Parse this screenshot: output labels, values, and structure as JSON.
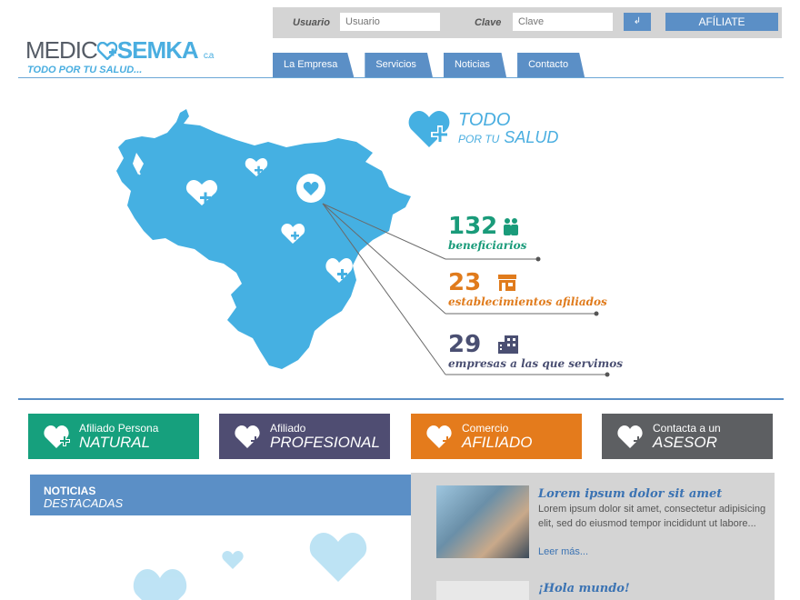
{
  "header": {
    "user_label": "Usuario",
    "user_placeholder": "Usuario",
    "pass_label": "Clave",
    "pass_placeholder": "Clave",
    "go_label": "↲",
    "join_label": "AFÍLIATE"
  },
  "logo": {
    "name_part1": "MEDIC",
    "name_part2": "SEMKA",
    "suffix": "c.a",
    "tagline": "TODO POR TU SALUD..."
  },
  "nav": [
    "La Empresa",
    "Servicios",
    "Noticias",
    "Contacto"
  ],
  "hero": {
    "title_top": "TODO",
    "title_bottom_small": "POR TU",
    "title_bottom": "SALUD"
  },
  "stats": [
    {
      "value": "132",
      "label": "beneficiarios",
      "color": "#1a9b7a",
      "icon": "people-icon"
    },
    {
      "value": "23",
      "label": "establecimientos afiliados",
      "color": "#e07b1c",
      "icon": "store-icon"
    },
    {
      "value": "29",
      "label": "empresas a las que servimos",
      "color": "#4a4f72",
      "icon": "building-icon"
    }
  ],
  "features": [
    {
      "small": "Afiliado Persona",
      "big": "NATURAL",
      "color": "#16a07d"
    },
    {
      "small": "Afiliado",
      "big": "PROFESIONAL",
      "color": "#4f4d72"
    },
    {
      "small": "Comercio",
      "big": "AFILIADO",
      "color": "#e47b1c"
    },
    {
      "small": "Contacta a un",
      "big": "ASESOR",
      "color": "#5d5f62"
    }
  ],
  "news": {
    "heading_top": "NOTICIAS",
    "heading_bottom": "DESTACADAS",
    "items": [
      {
        "title": "Lorem ipsum dolor sit amet",
        "excerpt": "Lorem ipsum dolor sit amet, consectetur adipisicing elit, sed do eiusmod tempor incididunt ut labore...",
        "more": "Leer más..."
      },
      {
        "title": "¡Hola mundo!"
      }
    ]
  },
  "colors": {
    "brand_blue": "#4aaee0",
    "nav_blue": "#5b8fc6"
  }
}
